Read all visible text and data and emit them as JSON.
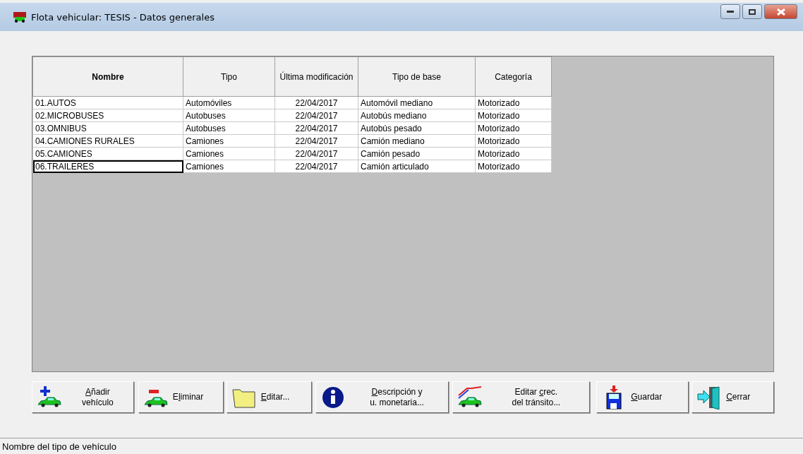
{
  "window": {
    "title": "Flota vehicular: TESIS - Datos generales"
  },
  "table": {
    "columns": [
      {
        "label": "Nombre",
        "bold": true
      },
      {
        "label": "Tipo",
        "bold": false
      },
      {
        "label": "Última modificación",
        "bold": false
      },
      {
        "label": "Tipo de base",
        "bold": false
      },
      {
        "label": "Categoría",
        "bold": false
      }
    ],
    "rows": [
      {
        "cells": [
          "01.AUTOS",
          "Automóviles",
          "22/04/2017",
          "Automóvil mediano",
          "Motorizado"
        ],
        "focused": false
      },
      {
        "cells": [
          "02.MICROBUSES",
          "Autobuses",
          "22/04/2017",
          "Autobús mediano",
          "Motorizado"
        ],
        "focused": false
      },
      {
        "cells": [
          "03.OMNIBUS",
          "Autobuses",
          "22/04/2017",
          "Autobús pesado",
          "Motorizado"
        ],
        "focused": false
      },
      {
        "cells": [
          "04.CAMIONES RURALES",
          "Camiones",
          "22/04/2017",
          "Camión mediano",
          "Motorizado"
        ],
        "focused": false
      },
      {
        "cells": [
          "05.CAMIONES",
          "Camiones",
          "22/04/2017",
          "Camión pesado",
          "Motorizado"
        ],
        "focused": false
      },
      {
        "cells": [
          "06.TRAILERES",
          "Camiones",
          "22/04/2017",
          "Camión articulado",
          "Motorizado"
        ],
        "focused": true
      }
    ]
  },
  "buttons": [
    {
      "kind": "add",
      "lines": [
        [
          {
            "text": "A",
            "underline": true
          },
          {
            "text": "ñadir",
            "underline": false
          }
        ],
        [
          {
            "text": "vehículo",
            "underline": false
          }
        ]
      ]
    },
    {
      "kind": "remove",
      "lines": [
        [
          {
            "text": "E",
            "underline": false
          },
          {
            "text": "l",
            "underline": true
          },
          {
            "text": "iminar",
            "underline": false
          }
        ]
      ]
    },
    {
      "kind": "folder",
      "lines": [
        [
          {
            "text": "E",
            "underline": true
          },
          {
            "text": "ditar...",
            "underline": false
          }
        ]
      ]
    },
    {
      "kind": "info",
      "lines": [
        [
          {
            "text": "D",
            "underline": true
          },
          {
            "text": "escripción y",
            "underline": false
          }
        ],
        [
          {
            "text": "u. monetaria...",
            "underline": false
          }
        ]
      ]
    },
    {
      "kind": "growth",
      "lines": [
        [
          {
            "text": "Editar ",
            "underline": false
          },
          {
            "text": "c",
            "underline": true
          },
          {
            "text": "rec.",
            "underline": false
          }
        ],
        [
          {
            "text": "del tránsito...",
            "underline": false
          }
        ]
      ]
    },
    {
      "kind": "save",
      "lines": [
        [
          {
            "text": "G",
            "underline": true
          },
          {
            "text": "uardar",
            "underline": false
          }
        ]
      ]
    },
    {
      "kind": "exit",
      "lines": [
        [
          {
            "text": "C",
            "underline": true
          },
          {
            "text": "errar",
            "underline": false
          }
        ]
      ]
    }
  ],
  "status_bar": {
    "text": "Nombre del tipo de vehículo"
  }
}
